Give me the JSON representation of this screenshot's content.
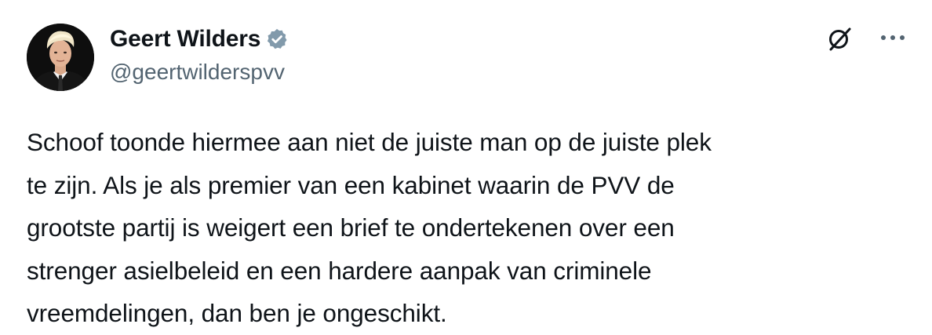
{
  "tweet": {
    "author": {
      "display_name": "Geert Wilders",
      "handle": "@geertwilderspvv",
      "verified": true,
      "verified_badge_color": "#829aab"
    },
    "text": "Schoof toonde hiermee aan niet de juiste man op de juiste plek\nte zijn. Als je als premier van een kabinet waarin de PVV de\ngrootste partij is weigert een brief te ondertekenen over een\nstrenger asielbeleid en een hardere aanpak van criminele\nvreemdelingen, dan ben je ongeschikt.",
    "icons": {
      "grok": "grok-icon",
      "more": "more-options-icon"
    }
  },
  "colors": {
    "text_primary": "#0f1419",
    "text_secondary": "#536471",
    "background": "#ffffff"
  }
}
